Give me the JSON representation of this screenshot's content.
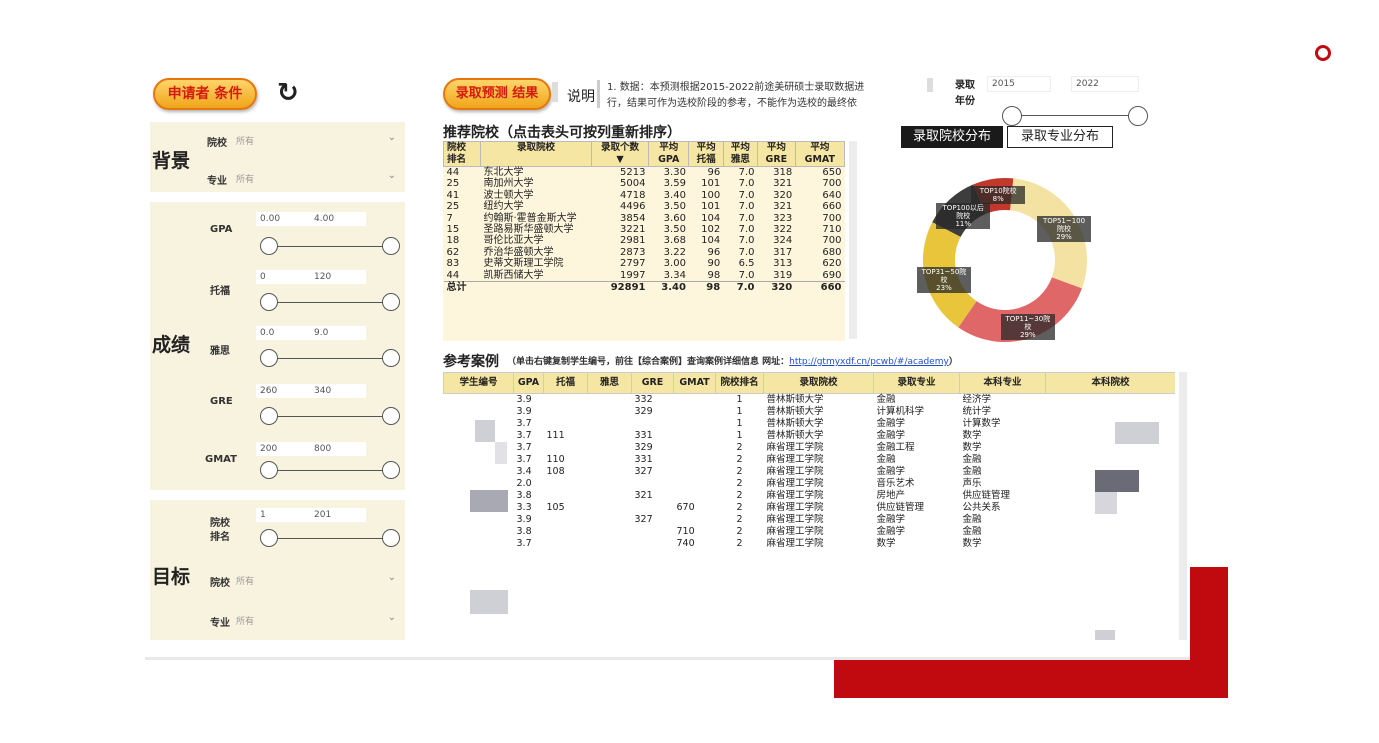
{
  "filters": {
    "applicant_button": "申请者 条件",
    "background_title": "背景",
    "school_label": "院校",
    "school_value": "所有",
    "major_label": "专业",
    "major_value": "所有",
    "scores_title": "成绩",
    "gpa_label": "GPA",
    "gpa_min": "0.00",
    "gpa_max": "4.00",
    "toefl_label": "托福",
    "toefl_min": "0",
    "toefl_max": "120",
    "ielts_label": "雅思",
    "ielts_min": "0.0",
    "ielts_max": "9.0",
    "gre_label": "GRE",
    "gre_min": "260",
    "gre_max": "340",
    "gmat_label": "GMAT",
    "gmat_min": "200",
    "gmat_max": "800",
    "target_title": "目标",
    "rank_label_1": "院校",
    "rank_label_2": "排名",
    "rank_min": "1",
    "rank_max": "201",
    "target_school_label": "院校",
    "target_school_value": "所有",
    "target_major_label": "专业",
    "target_major_value": "所有"
  },
  "header": {
    "result_button": "录取预测 结果",
    "explain_label": "说明",
    "note_line1": "1. 数据：本预测根据2015-2022前途美研硕士录取数据进",
    "note_line2": "行，结果可作为选校阶段的参考，不能作为选校的最终依",
    "year_label_1": "录取",
    "year_label_2": "年份",
    "year_from": "2015",
    "year_to": "2022"
  },
  "recommend": {
    "title": "推荐院校（点击表头可按列重新排序）",
    "headers": [
      "院校排名",
      "录取院校",
      "录取个数",
      "平均GPA",
      "平均托福",
      "平均雅思",
      "平均GRE",
      "平均GMAT"
    ],
    "h0a": "院校",
    "h0b": "排名",
    "h1": "录取院校",
    "h2": "录取个数",
    "h3a": "平均",
    "h3b": "GPA",
    "h4a": "平均",
    "h4b": "托福",
    "h5a": "平均",
    "h5b": "雅思",
    "h6a": "平均",
    "h6b": "GRE",
    "h7a": "平均",
    "h7b": "GMAT",
    "rows": [
      {
        "rank": "44",
        "school": "东北大学",
        "count": "5213",
        "gpa": "3.30",
        "toefl": "96",
        "ielts": "7.0",
        "gre": "318",
        "gmat": "650"
      },
      {
        "rank": "25",
        "school": "南加州大学",
        "count": "5004",
        "gpa": "3.59",
        "toefl": "101",
        "ielts": "7.0",
        "gre": "321",
        "gmat": "700"
      },
      {
        "rank": "41",
        "school": "波士顿大学",
        "count": "4718",
        "gpa": "3.40",
        "toefl": "100",
        "ielts": "7.0",
        "gre": "320",
        "gmat": "640"
      },
      {
        "rank": "25",
        "school": "纽约大学",
        "count": "4496",
        "gpa": "3.50",
        "toefl": "101",
        "ielts": "7.0",
        "gre": "321",
        "gmat": "660"
      },
      {
        "rank": "7",
        "school": "约翰斯·霍普金斯大学",
        "count": "3854",
        "gpa": "3.60",
        "toefl": "104",
        "ielts": "7.0",
        "gre": "323",
        "gmat": "700"
      },
      {
        "rank": "15",
        "school": "圣路易斯华盛顿大学",
        "count": "3221",
        "gpa": "3.50",
        "toefl": "102",
        "ielts": "7.0",
        "gre": "322",
        "gmat": "710"
      },
      {
        "rank": "18",
        "school": "哥伦比亚大学",
        "count": "2981",
        "gpa": "3.68",
        "toefl": "104",
        "ielts": "7.0",
        "gre": "324",
        "gmat": "700"
      },
      {
        "rank": "62",
        "school": "乔治华盛顿大学",
        "count": "2873",
        "gpa": "3.22",
        "toefl": "96",
        "ielts": "7.0",
        "gre": "317",
        "gmat": "680"
      },
      {
        "rank": "83",
        "school": "史蒂文斯理工学院",
        "count": "2797",
        "gpa": "3.00",
        "toefl": "90",
        "ielts": "6.5",
        "gre": "313",
        "gmat": "620"
      },
      {
        "rank": "44",
        "school": "凯斯西储大学",
        "count": "1997",
        "gpa": "3.34",
        "toefl": "98",
        "ielts": "7.0",
        "gre": "319",
        "gmat": "690"
      }
    ],
    "total": {
      "label": "总计",
      "count": "92891",
      "gpa": "3.40",
      "toefl": "98",
      "ielts": "7.0",
      "gre": "320",
      "gmat": "660"
    }
  },
  "distribution": {
    "tab_school": "录取院校分布",
    "tab_major": "录取专业分布",
    "segments": [
      {
        "label": "TOP10院校",
        "pct_label": "8%",
        "value": 8,
        "color": "#c0392b"
      },
      {
        "label": "TOP51~100院校",
        "pct_label": "29%",
        "value": 29,
        "color": "#f4e2a2"
      },
      {
        "label": "TOP11~30院校",
        "pct_label": "29%",
        "value": 29,
        "color": "#e06767"
      },
      {
        "label": "TOP31~50院校",
        "pct_label": "23%",
        "value": 23,
        "color": "#e8c53a"
      },
      {
        "label": "TOP100以后院校",
        "pct_label": "11%",
        "value": 11,
        "color": "#3d3d3d"
      }
    ]
  },
  "cases": {
    "title": "参考案例",
    "hint_prefix": "（单击右键复制学生编号，前往【综合案例】查询案例详细信息  网址：",
    "hint_url": "http://gtmyxdf.cn/pcwb/#/academy",
    "hint_suffix": "）",
    "headers": [
      "学生编号",
      "GPA",
      "托福",
      "雅思",
      "GRE",
      "GMAT",
      "院校排名",
      "录取院校",
      "录取专业",
      "本科专业",
      "本科院校"
    ],
    "rows": [
      {
        "gpa": "3.9",
        "toefl": "",
        "ielts": "",
        "gre": "332",
        "gmat": "",
        "rank": "1",
        "school": "普林斯顿大学",
        "major": "金融",
        "ug_major": "经济学"
      },
      {
        "gpa": "3.9",
        "toefl": "",
        "ielts": "",
        "gre": "329",
        "gmat": "",
        "rank": "1",
        "school": "普林斯顿大学",
        "major": "计算机科学",
        "ug_major": "统计学"
      },
      {
        "gpa": "3.7",
        "toefl": "",
        "ielts": "",
        "gre": "",
        "gmat": "",
        "rank": "1",
        "school": "普林斯顿大学",
        "major": "金融学",
        "ug_major": "计算数学"
      },
      {
        "gpa": "3.7",
        "toefl": "111",
        "ielts": "",
        "gre": "331",
        "gmat": "",
        "rank": "1",
        "school": "普林斯顿大学",
        "major": "金融学",
        "ug_major": "数学"
      },
      {
        "gpa": "3.7",
        "toefl": "",
        "ielts": "",
        "gre": "329",
        "gmat": "",
        "rank": "2",
        "school": "麻省理工学院",
        "major": "金融工程",
        "ug_major": "数学"
      },
      {
        "gpa": "3.7",
        "toefl": "110",
        "ielts": "",
        "gre": "331",
        "gmat": "",
        "rank": "2",
        "school": "麻省理工学院",
        "major": "金融",
        "ug_major": "金融"
      },
      {
        "gpa": "3.4",
        "toefl": "108",
        "ielts": "",
        "gre": "327",
        "gmat": "",
        "rank": "2",
        "school": "麻省理工学院",
        "major": "金融学",
        "ug_major": "金融"
      },
      {
        "gpa": "2.0",
        "toefl": "",
        "ielts": "",
        "gre": "",
        "gmat": "",
        "rank": "2",
        "school": "麻省理工学院",
        "major": "音乐艺术",
        "ug_major": "声乐"
      },
      {
        "gpa": "3.8",
        "toefl": "",
        "ielts": "",
        "gre": "321",
        "gmat": "",
        "rank": "2",
        "school": "麻省理工学院",
        "major": "房地产",
        "ug_major": "供应链管理"
      },
      {
        "gpa": "3.3",
        "toefl": "105",
        "ielts": "",
        "gre": "",
        "gmat": "670",
        "rank": "2",
        "school": "麻省理工学院",
        "major": "供应链管理",
        "ug_major": "公共关系"
      },
      {
        "gpa": "3.9",
        "toefl": "",
        "ielts": "",
        "gre": "327",
        "gmat": "",
        "rank": "2",
        "school": "麻省理工学院",
        "major": "金融学",
        "ug_major": "金融"
      },
      {
        "gpa": "3.8",
        "toefl": "",
        "ielts": "",
        "gre": "",
        "gmat": "710",
        "rank": "2",
        "school": "麻省理工学院",
        "major": "金融学",
        "ug_major": "金融"
      },
      {
        "gpa": "3.7",
        "toefl": "",
        "ielts": "",
        "gre": "",
        "gmat": "740",
        "rank": "2",
        "school": "麻省理工学院",
        "major": "数学",
        "ug_major": "数学"
      }
    ]
  }
}
